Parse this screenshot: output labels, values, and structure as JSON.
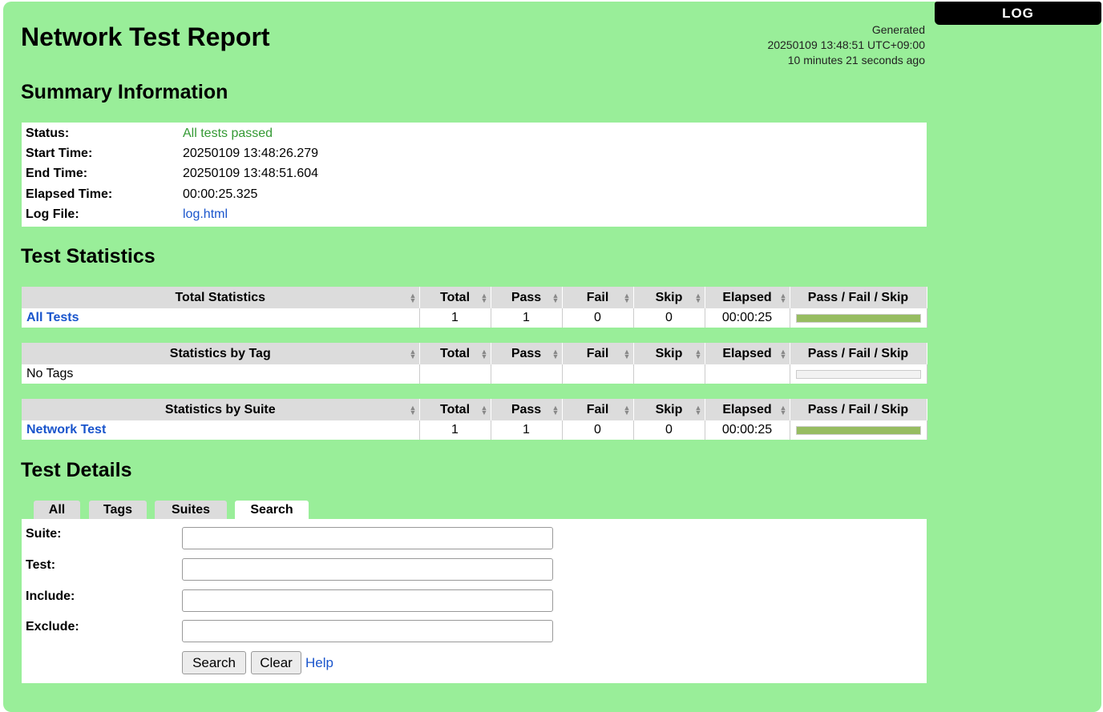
{
  "log_tab": "LOG",
  "header": {
    "title": "Network Test Report",
    "generated_label": "Generated",
    "generated_time": "20250109 13:48:51 UTC+09:00",
    "generated_ago": "10 minutes 21 seconds ago"
  },
  "summary": {
    "heading": "Summary Information",
    "rows": [
      {
        "label": "Status:",
        "value": "All tests passed"
      },
      {
        "label": "Start Time:",
        "value": "20250109 13:48:26.279"
      },
      {
        "label": "End Time:",
        "value": "20250109 13:48:51.604"
      },
      {
        "label": "Elapsed Time:",
        "value": "00:00:25.325"
      },
      {
        "label": "Log File:",
        "value": "log.html"
      }
    ]
  },
  "statistics": {
    "heading": "Test Statistics",
    "columns": [
      "Total",
      "Pass",
      "Fail",
      "Skip",
      "Elapsed",
      "Pass / Fail / Skip"
    ],
    "total": {
      "title": "Total Statistics",
      "row": {
        "name": "All Tests",
        "total": "1",
        "pass": "1",
        "fail": "0",
        "skip": "0",
        "elapsed": "00:00:25"
      }
    },
    "tag": {
      "title": "Statistics by Tag",
      "empty": "No Tags"
    },
    "suite": {
      "title": "Statistics by Suite",
      "row": {
        "name": "Network Test",
        "total": "1",
        "pass": "1",
        "fail": "0",
        "skip": "0",
        "elapsed": "00:00:25"
      }
    },
    "pass_fraction": 1.0
  },
  "details": {
    "heading": "Test Details",
    "tabs": [
      "All",
      "Tags",
      "Suites",
      "Search"
    ],
    "active_tab": "Search",
    "fields": [
      {
        "label": "Suite:",
        "value": ""
      },
      {
        "label": "Test:",
        "value": ""
      },
      {
        "label": "Include:",
        "value": ""
      },
      {
        "label": "Exclude:",
        "value": ""
      }
    ],
    "search_button": "Search",
    "clear_button": "Clear",
    "help_link": "Help"
  },
  "colors": {
    "background": "#99ee99",
    "pass_bar": "#97bd61",
    "link": "#1a55cc",
    "pass_text": "#339933"
  }
}
